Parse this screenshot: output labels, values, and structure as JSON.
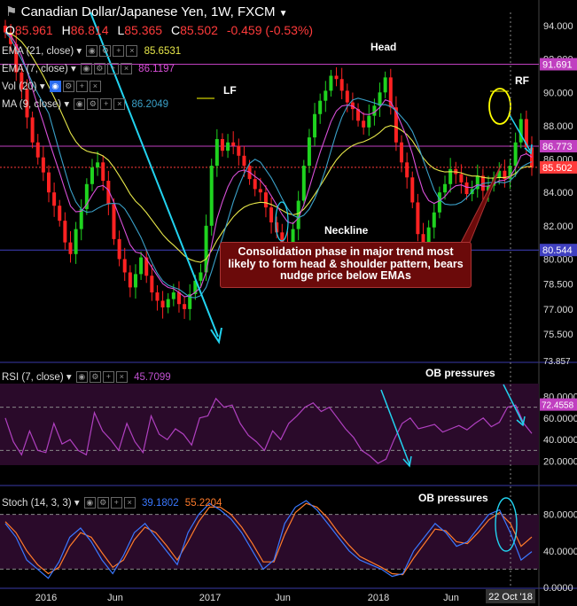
{
  "header": {
    "title": "Canadian Dollar/Japanese Yen, 1W, FXCM",
    "ohlc": {
      "o_label": "O",
      "o": "85.961",
      "h_label": "H",
      "h": "86.814",
      "l_label": "L",
      "l": "85.365",
      "c_label": "C",
      "c": "85.502",
      "change": "-0.459 (-0.53%)"
    }
  },
  "indicators": {
    "ema21": {
      "label": "EMA (21, close)",
      "value": "85.6531",
      "color": "#e8e84a"
    },
    "ema7": {
      "label": "EMA (7, close)",
      "value": "86.1197",
      "color": "#d84fd8"
    },
    "vol": {
      "label": "Vol (20)"
    },
    "ma9": {
      "label": "MA (9, close)",
      "value": "86.2049",
      "color": "#3aa0c8"
    },
    "rsi": {
      "label": "RSI (7, close)",
      "value": "45.7099",
      "color": "#b040c0"
    },
    "stoch": {
      "label": "Stoch (14, 3, 3)",
      "k_value": "39.1802",
      "d_value": "55.2204",
      "k_color": "#3a78ff",
      "d_color": "#ff7b2b"
    }
  },
  "annotations": {
    "head": "Head",
    "lf": "LF",
    "rf": "RF",
    "neckline": "Neckline",
    "rsi_ob": "OB pressures",
    "stoch_ob": "OB pressures",
    "callout": "Consolidation phase in major trend most likely to form head & shoulder pattern, bears nudge price below EMAs"
  },
  "price_axis": {
    "ticks": [
      "94.000",
      "92.000",
      "90.000",
      "88.000",
      "86.000",
      "84.000",
      "82.000",
      "80.000",
      "78.500",
      "77.000",
      "75.500"
    ],
    "levels": [
      {
        "value": "91.691",
        "color": "#c040c0"
      },
      {
        "value": "86.773",
        "color": "#c040c0"
      },
      {
        "value": "85.502",
        "color": "#ff3b3b"
      },
      {
        "value": "80.544",
        "color": "#4040c0"
      }
    ],
    "low_label": "73.857"
  },
  "rsi_axis": {
    "ticks": [
      "80.0000",
      "60.0000",
      "40.0000",
      "20.0000"
    ],
    "current": "72.4558"
  },
  "stoch_axis": {
    "ticks": [
      "80.0000",
      "40.0000",
      "0.0000"
    ]
  },
  "time_axis": {
    "ticks": [
      "2016",
      "Jun",
      "2017",
      "Jun",
      "2018",
      "Jun"
    ],
    "cursor": "22 Oct '18"
  },
  "colors": {
    "up": "#1fd31f",
    "down": "#ff2222",
    "trend": "#22d3f0",
    "yellow_mark": "#ffff00"
  },
  "chart_data": {
    "type": "candlestick",
    "title": "Canadian Dollar/Japanese Yen, 1W, FXCM",
    "ylim": [
      73.857,
      94.8
    ],
    "series": [
      {
        "name": "Price",
        "close": [
          93.6,
          92.9,
          91.2,
          90.2,
          88.5,
          87.0,
          86.1,
          85.2,
          84.0,
          83.2,
          82.3,
          81.0,
          80.3,
          81.8,
          83.0,
          84.5,
          85.5,
          85.8,
          84.7,
          83.3,
          81.2,
          80.0,
          79.2,
          78.3,
          79.1,
          80.1,
          79.0,
          78.0,
          77.5,
          77.1,
          77.6,
          78.0,
          77.3,
          77.0,
          77.9,
          78.7,
          79.2,
          82.0,
          85.6,
          87.2,
          86.5,
          87.0,
          86.8,
          86.2,
          85.6,
          84.8,
          84.2,
          84.0,
          83.1,
          82.2,
          81.6,
          81.0,
          80.9,
          81.8,
          83.5,
          85.6,
          87.3,
          88.7,
          89.5,
          90.1,
          91.0,
          90.8,
          90.1,
          89.4,
          89.0,
          88.3,
          87.9,
          88.6,
          89.2,
          90.0,
          90.9,
          89.1,
          87.0,
          85.8,
          84.9,
          83.4,
          81.5,
          80.9,
          81.9,
          82.8,
          84.0,
          84.5,
          85.4,
          85.1,
          84.6,
          83.9,
          84.2,
          85.0,
          84.1,
          84.4,
          84.9,
          85.3,
          84.8,
          85.6,
          87.0,
          88.4,
          86.7,
          85.5
        ]
      }
    ],
    "levels": [
      91.691,
      86.773,
      85.502,
      80.544
    ],
    "ema21_last": 85.6531,
    "ema7_last": 86.1197,
    "ma9_last": 86.2049,
    "rsi": {
      "label": "RSI (7, close)",
      "ylim": [
        0,
        100
      ],
      "last": 45.7099,
      "values": [
        60,
        38,
        26,
        48,
        30,
        28,
        55,
        36,
        40,
        30,
        26,
        65,
        48,
        40,
        30,
        55,
        38,
        28,
        62,
        45,
        40,
        50,
        45,
        35,
        60,
        62,
        78,
        70,
        72,
        55,
        44,
        38,
        30,
        48,
        40,
        55,
        62,
        70,
        74,
        66,
        70,
        60,
        50,
        42,
        30,
        25,
        18,
        22,
        40,
        55,
        60,
        50,
        52,
        54,
        47,
        50,
        53,
        49,
        55,
        60,
        52,
        56,
        70,
        72,
        55,
        45.7
      ]
    },
    "stoch": {
      "label": "Stoch (14, 3, 3)",
      "ylim": [
        0,
        100
      ],
      "k": [
        70,
        55,
        30,
        20,
        10,
        28,
        55,
        65,
        50,
        30,
        15,
        35,
        60,
        70,
        55,
        40,
        25,
        60,
        80,
        92,
        85,
        75,
        60,
        40,
        20,
        30,
        70,
        88,
        95,
        85,
        70,
        55,
        40,
        30,
        25,
        20,
        12,
        15,
        40,
        55,
        70,
        60,
        45,
        50,
        65,
        80,
        85,
        60,
        30,
        39.18
      ],
      "d": [
        72,
        60,
        40,
        25,
        15,
        22,
        45,
        60,
        55,
        38,
        22,
        30,
        52,
        66,
        60,
        46,
        30,
        50,
        72,
        88,
        88,
        80,
        66,
        48,
        28,
        28,
        58,
        82,
        92,
        88,
        76,
        60,
        46,
        34,
        28,
        22,
        15,
        14,
        32,
        48,
        64,
        62,
        50,
        48,
        60,
        74,
        82,
        70,
        45,
        55.22
      ]
    }
  }
}
